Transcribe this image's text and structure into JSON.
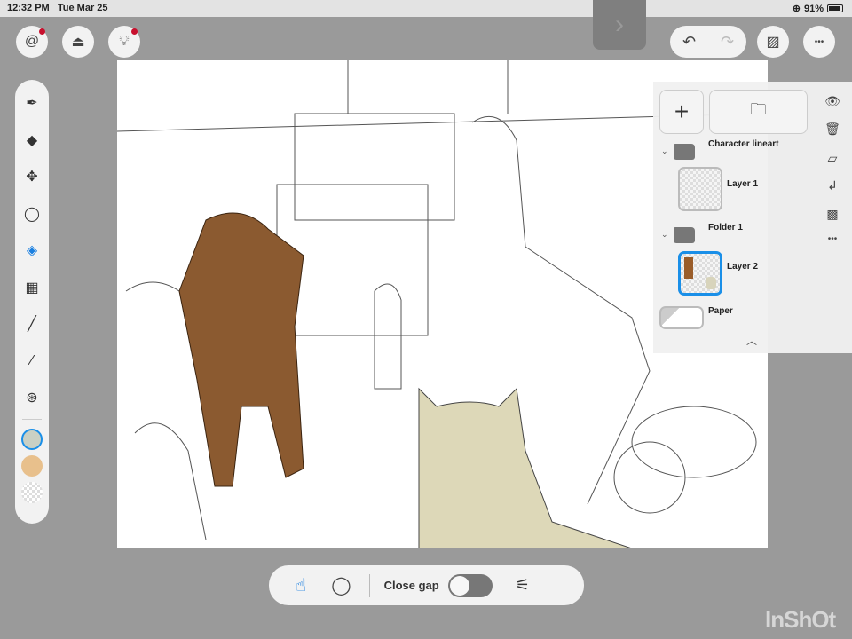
{
  "status": {
    "time": "12:32 PM",
    "date": "Tue Mar 25",
    "battery": "91%"
  },
  "top": {
    "gallery_icon": "spiral-icon",
    "import_icon": "download-tray-icon",
    "tips_icon": "lightbulb-icon",
    "next_symbol": "›",
    "undo": "↶",
    "redo": "↷",
    "more": "•••"
  },
  "tools": [
    {
      "name": "pen-tool",
      "sym": "✒"
    },
    {
      "name": "eraser-tool",
      "sym": "◆"
    },
    {
      "name": "move-tool",
      "sym": "✥"
    },
    {
      "name": "lasso-tool",
      "sym": "◯"
    },
    {
      "name": "fill-tool",
      "sym": "◈",
      "active": true
    },
    {
      "name": "transform-tool",
      "sym": "▦"
    },
    {
      "name": "line-tool",
      "sym": "╱"
    },
    {
      "name": "eyedropper-tool",
      "sym": "⁄"
    },
    {
      "name": "blend-tool",
      "sym": "⊛"
    }
  ],
  "colors": {
    "primary": "#c9d0c4",
    "secondary": "#e8c08c",
    "accent": "#1a8fe8"
  },
  "layers": {
    "items": [
      {
        "type": "folder",
        "name": "Character lineart"
      },
      {
        "type": "layer",
        "name": "Layer 1"
      },
      {
        "type": "folder",
        "name": "Folder 1"
      },
      {
        "type": "layer",
        "name": "Layer 2",
        "selected": true
      },
      {
        "type": "paper",
        "name": "Paper"
      }
    ]
  },
  "bottom": {
    "close_gap_label": "Close gap",
    "close_gap_on": false
  },
  "watermark": "InShOt"
}
